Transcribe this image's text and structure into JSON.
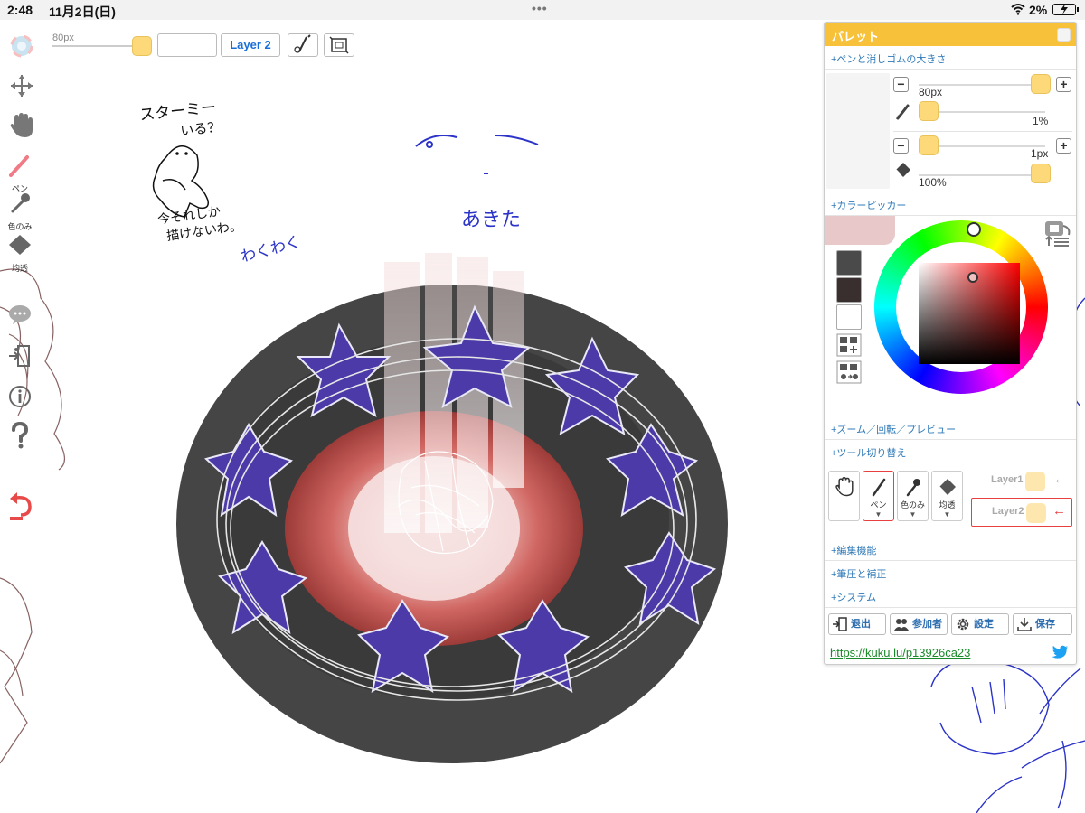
{
  "status_bar": {
    "time": "2:48",
    "date": "11月2日(日)",
    "dots": "•••",
    "battery_percent": "2%"
  },
  "canvas": {
    "texts": [
      "スターミー",
      "いる？",
      "今それしか",
      "描けないわ。",
      "わくわく",
      "あきた"
    ]
  },
  "left_toolbar": {
    "pen_label": "ペン",
    "color_pick_label": "色のみ",
    "transparent_label": "均透"
  },
  "top_bar": {
    "brush_size": "80px",
    "layer_button": "Layer 2"
  },
  "palette": {
    "title": "パレット",
    "sections": {
      "pen_eraser_size": "+ペンと消しゴムの大きさ",
      "color_picker": "+カラーピッカー",
      "zoom": "+ズーム／回転／プレビュー",
      "tool_switch": "+ツール切り替え",
      "edit": "+編集機能",
      "pressure": "+筆圧と補正",
      "system": "+システム"
    },
    "pen": {
      "size": "80px",
      "opacity": "1%",
      "size_level": 1.0,
      "opacity_level": 0.0
    },
    "eraser": {
      "size": "1px",
      "opacity": "100%",
      "size_level": 0.0,
      "opacity_level": 1.0
    },
    "swatches": [
      "#4a4a4a",
      "#3a2f2f",
      "#ffffff"
    ],
    "current_color": "#e8c8c8",
    "tools": {
      "pen_label": "ペン",
      "color_only_label": "色のみ",
      "transparent_label": "均透",
      "selected": "pen"
    },
    "layers": [
      {
        "name": "Layer1",
        "selected": false
      },
      {
        "name": "Layer2",
        "selected": true
      }
    ],
    "actions": {
      "exit": "退出",
      "participants": "参加者",
      "settings": "設定",
      "save": "保存"
    },
    "link": "https://kuku.lu/p13926ca23"
  },
  "colors": {
    "accent": "#f7c23a",
    "knob": "#fdd97a",
    "link_blue": "#2f7ab8",
    "select_red": "#e84040"
  }
}
